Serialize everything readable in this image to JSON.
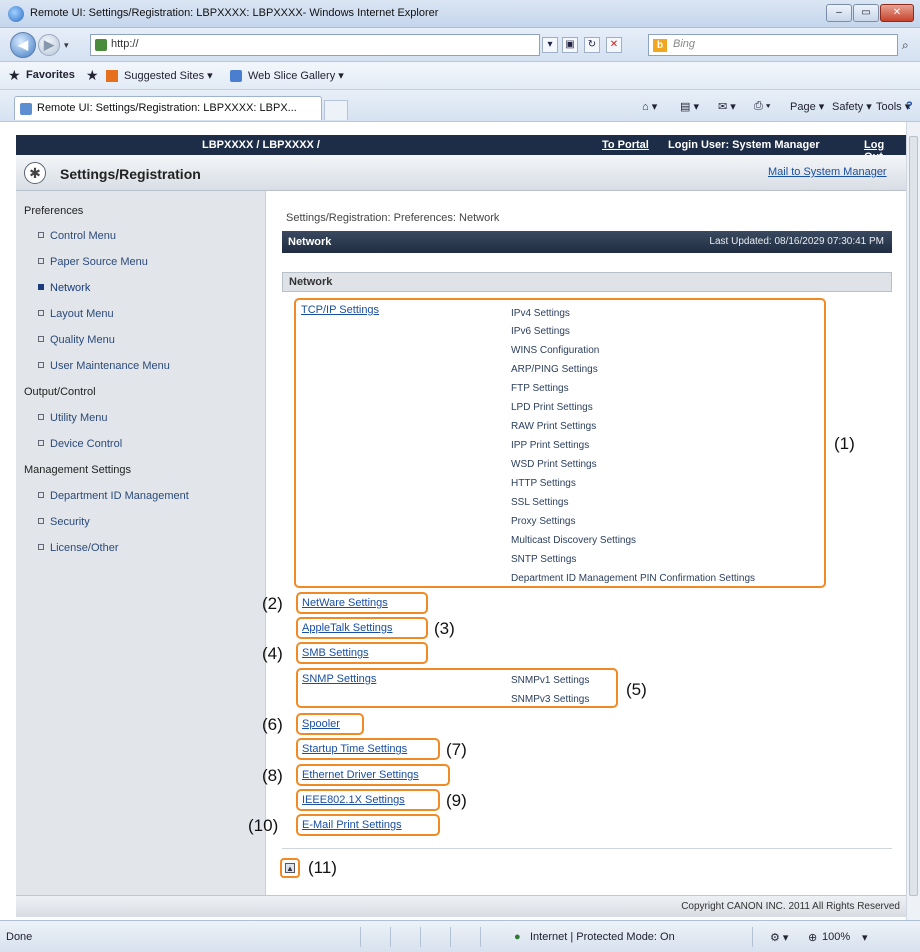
{
  "window": {
    "title": "Remote UI: Settings/Registration: LBPXXXX: LBPXXXX- Windows Internet Explorer",
    "buttons": [
      "–",
      "▭",
      "✕"
    ]
  },
  "address": {
    "url": "http://",
    "search_placeholder": "Bing"
  },
  "favorites": {
    "favorites_label": "Favorites",
    "suggested": "Suggested Sites ▾",
    "webslice": "Web Slice Gallery ▾"
  },
  "tab": {
    "title": "Remote UI: Settings/Registration: LBPXXXX: LBPX..."
  },
  "commands": {
    "page": "Page ▾",
    "safety": "Safety ▾",
    "tools": "Tools ▾",
    "help": "?"
  },
  "topbar": {
    "device": "LBPXXXX / LBPXXXX /",
    "portal": "To Portal",
    "login": "Login User: System Manager",
    "logout": "Log Out"
  },
  "header": {
    "title": "Settings/Registration",
    "mail": "Mail to System Manager"
  },
  "sidebar": {
    "preferences": "Preferences",
    "pref_items": [
      "Control Menu",
      "Paper Source Menu",
      "Network",
      "Layout Menu",
      "Quality Menu",
      "User Maintenance Menu"
    ],
    "output": "Output/Control",
    "output_items": [
      "Utility Menu",
      "Device Control"
    ],
    "management": "Management Settings",
    "management_items": [
      "Department ID Management",
      "Security",
      "License/Other"
    ]
  },
  "main": {
    "breadcrumb": "Settings/Registration: Preferences: Network",
    "section_title": "Network",
    "last_updated": "Last Updated: 08/16/2029 07:30:41 PM",
    "subsection": "Network",
    "tcpip": "TCP/IP Settings",
    "tcpip_items": [
      "IPv4 Settings",
      "IPv6 Settings",
      "WINS Configuration",
      "ARP/PING Settings",
      "FTP Settings",
      "LPD Print Settings",
      "RAW Print Settings",
      "IPP Print Settings",
      "WSD Print Settings",
      "HTTP Settings",
      "SSL Settings",
      "Proxy Settings",
      "Multicast Discovery Settings",
      "SNTP Settings",
      "Department ID Management PIN Confirmation Settings"
    ],
    "netware": "NetWare Settings",
    "appletalk": "AppleTalk Settings",
    "smb": "SMB Settings",
    "snmp": "SNMP Settings",
    "snmp_items": [
      "SNMPv1 Settings",
      "SNMPv3 Settings"
    ],
    "spooler": "Spooler",
    "startup": "Startup Time Settings",
    "ethernet": "Ethernet Driver Settings",
    "ieee": "IEEE802.1X Settings",
    "email": "E-Mail Print Settings"
  },
  "callouts": [
    "(1)",
    "(2)",
    "(3)",
    "(4)",
    "(5)",
    "(6)",
    "(7)",
    "(8)",
    "(9)",
    "(10)",
    "(11)"
  ],
  "copyright": "Copyright CANON INC. 2011 All Rights Reserved",
  "status": {
    "left": "Done",
    "zone": "Internet | Protected Mode: On",
    "zoom": "100%"
  },
  "colors": {
    "callout_border": "#f08a24",
    "topbar": "#1e2d47",
    "link": "#1a4fa3"
  }
}
